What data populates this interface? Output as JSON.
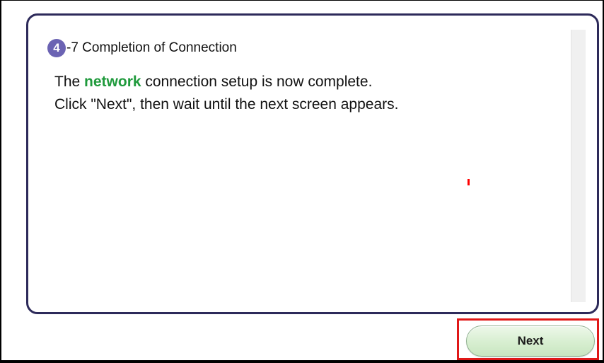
{
  "step": {
    "number": "4",
    "title": "-7 Completion of Connection"
  },
  "message": {
    "line1_before": "The ",
    "line1_highlight": "network",
    "line1_after": " connection setup is now complete.",
    "line2": "Click \"Next\", then wait until the next screen appears."
  },
  "footer": {
    "next_label": "Next"
  },
  "colors": {
    "panel_border": "#2d2a5a",
    "step_badge": "#6b63b3",
    "highlight_text": "#1f9a3c",
    "next_button_fill": "#d9efd2",
    "focus_highlight": "#e01818"
  }
}
